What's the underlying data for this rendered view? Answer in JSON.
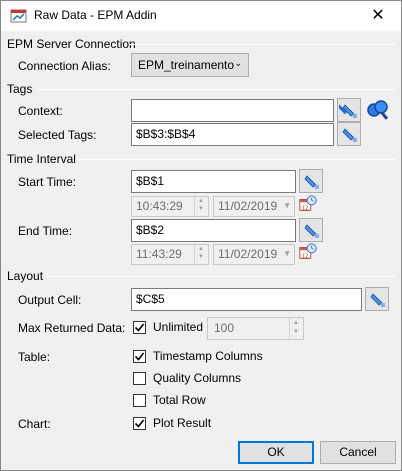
{
  "window": {
    "title": "Raw Data - EPM Addin"
  },
  "server": {
    "section": "EPM Server Connection",
    "alias_label": "Connection Alias:",
    "alias_value": "EPM_treinamento"
  },
  "tags": {
    "section": "Tags",
    "context_label": "Context:",
    "context_value": "",
    "selected_label": "Selected Tags:",
    "selected_value": "$B$3:$B$4"
  },
  "interval": {
    "section": "Time Interval",
    "start_label": "Start Time:",
    "start_value": "$B$1",
    "start_time": "10:43:29",
    "start_date": "11/02/2019",
    "end_label": "End Time:",
    "end_value": "$B$2",
    "end_time": "11:43:29",
    "end_date": "11/02/2019"
  },
  "layout": {
    "section": "Layout",
    "output_label": "Output Cell:",
    "output_value": "$C$5",
    "max_label": "Max Returned Data:",
    "unlimited_label": "Unlimited",
    "unlimited_checked": true,
    "max_value": "100",
    "table_label": "Table:",
    "timestamp_label": "Timestamp Columns",
    "timestamp_checked": true,
    "quality_label": "Quality Columns",
    "quality_checked": false,
    "total_label": "Total Row",
    "total_checked": false,
    "chart_label": "Chart:",
    "plot_label": "Plot Result",
    "plot_checked": true
  },
  "buttons": {
    "ok": "OK",
    "cancel": "Cancel"
  },
  "colors": {
    "accent": "#0078d7",
    "picker_blue": "#1f6fd1"
  }
}
